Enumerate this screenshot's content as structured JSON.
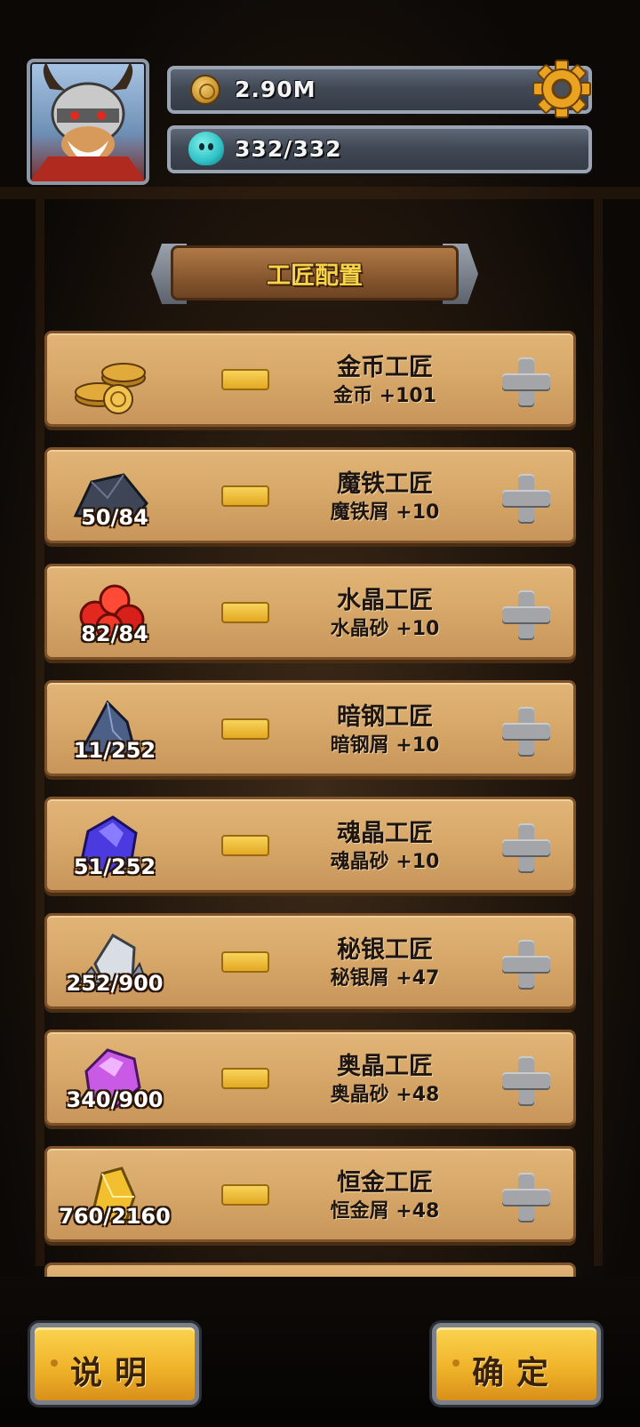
{
  "hud": {
    "gold_value": "2.90M",
    "stamina_value": "332/332"
  },
  "title": "工匠配置",
  "craftsmen": [
    {
      "icon": "gold-coin-stack-icon",
      "count": "",
      "name": "金币工匠",
      "bonus": "金币 +101"
    },
    {
      "icon": "dark-iron-ore-icon",
      "count": "50/84",
      "name": "魔铁工匠",
      "bonus": "魔铁屑 +10"
    },
    {
      "icon": "red-crystal-icon",
      "count": "82/84",
      "name": "水晶工匠",
      "bonus": "水晶砂 +10"
    },
    {
      "icon": "dark-steel-ore-icon",
      "count": "11/252",
      "name": "暗钢工匠",
      "bonus": "暗钢屑 +10"
    },
    {
      "icon": "soul-crystal-icon",
      "count": "51/252",
      "name": "魂晶工匠",
      "bonus": "魂晶砂 +10"
    },
    {
      "icon": "mithril-ore-icon",
      "count": "252/900",
      "name": "秘银工匠",
      "bonus": "秘银屑 +47"
    },
    {
      "icon": "arcane-crystal-icon",
      "count": "340/900",
      "name": "奥晶工匠",
      "bonus": "奥晶砂 +48"
    },
    {
      "icon": "eternal-gold-ore-icon",
      "count": "760/2160",
      "name": "恒金工匠",
      "bonus": "恒金屑 +48"
    }
  ],
  "buttons": {
    "help": "说明",
    "confirm": "确定"
  },
  "colors": {
    "card": "#d6a769",
    "title_text": "#f6d34a",
    "button_gold": "#f0b42a"
  }
}
